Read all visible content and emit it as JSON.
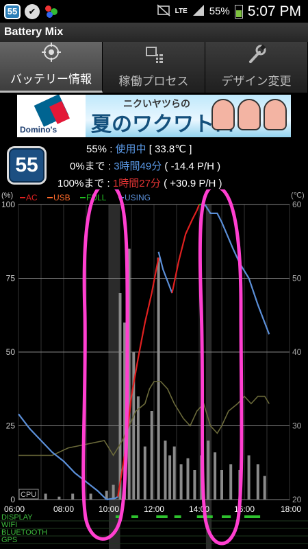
{
  "status_bar": {
    "badge": "55",
    "network": "LTE",
    "battery": "55%",
    "battery_level": 0.55,
    "time": "5:07 PM",
    "icons": [
      "battery-mix-badge-icon",
      "vine-icon",
      "app-icon",
      "mute-icon",
      "lte-icon",
      "signal-icon",
      "battery-icon"
    ]
  },
  "app": {
    "title": "Battery Mix"
  },
  "tabs": [
    {
      "label": "バッテリー情報",
      "icon": "target-icon",
      "active": true
    },
    {
      "label": "稼働プロセス",
      "icon": "process-list-icon",
      "active": false
    },
    {
      "label": "デザイン変更",
      "icon": "wrench-icon",
      "active": false
    }
  ],
  "ad": {
    "brand": "Domino's",
    "subtitle": "ニクいヤツらの",
    "title": "夏のワクワトロ"
  },
  "info": {
    "badge_value": "55",
    "level": "55%",
    "colon1": " : ",
    "state": "使用中",
    "temp": " [ 33.8℃ ]",
    "empty_label": "0%まで",
    "colon2": " : ",
    "empty_time": "3時間49分",
    "empty_rate": " ( -14.4 P/H )",
    "full_label": "100%まで",
    "colon3": " : ",
    "full_time": "1時間27分",
    "full_rate": " ( +30.9 P/H )"
  },
  "colors": {
    "ac": "#e02020",
    "usb": "#ff6a2a",
    "full": "#22c022",
    "using": "#5b8fd8",
    "highlight": "#ff3fd0"
  },
  "chart_data": {
    "type": "line",
    "legend": [
      "AC",
      "USB",
      "FULL",
      "USING"
    ],
    "left_axis_unit": "(%)",
    "right_axis_unit": "(℃)",
    "y_ticks": [
      0,
      25,
      50,
      75,
      100
    ],
    "y_right_ticks": [
      20,
      30,
      40,
      50,
      60
    ],
    "x_ticks": [
      "06:00",
      "08:00",
      "10:00",
      "12:00",
      "14:00",
      "16:00",
      "18:00"
    ],
    "xlim": [
      6,
      18
    ],
    "ylim": [
      0,
      100
    ],
    "y_right_lim": [
      20,
      60
    ],
    "bar_series_label": "CPU",
    "activity_rows": [
      "DISPLAY",
      "WIFI",
      "BLUETOOTH",
      "GPS"
    ],
    "series": [
      {
        "name": "USING",
        "color": "#5b8fd8",
        "x": [
          6.0,
          6.5,
          7.0,
          7.5,
          8.0,
          8.5,
          9.0,
          9.5,
          9.9
        ],
        "y": [
          29,
          24,
          20,
          16,
          13,
          9,
          6,
          3,
          0
        ]
      },
      {
        "name": "USING",
        "color": "#5b8fd8",
        "x": [
          9.9,
          10.3,
          10.4
        ],
        "y": [
          0,
          0.5,
          1
        ]
      },
      {
        "name": "AC",
        "color": "#e02020",
        "x": [
          10.4,
          10.7,
          11.0,
          11.3,
          11.6,
          11.9,
          12.2
        ],
        "y": [
          1,
          15,
          35,
          48,
          60,
          70,
          82
        ]
      },
      {
        "name": "USING",
        "color": "#5b8fd8",
        "x": [
          12.2,
          12.4,
          12.7,
          12.8
        ],
        "y": [
          84,
          78,
          72,
          70
        ]
      },
      {
        "name": "AC",
        "color": "#e02020",
        "x": [
          12.8,
          13.1,
          13.4,
          13.7,
          13.9,
          14.0
        ],
        "y": [
          70,
          81,
          90,
          95,
          98,
          100
        ]
      },
      {
        "name": "FULL",
        "color": "#22c022",
        "x": [
          14.0,
          14.25
        ],
        "y": [
          100,
          100
        ]
      },
      {
        "name": "USING",
        "color": "#5b8fd8",
        "x": [
          14.25,
          14.5,
          14.8,
          15.0,
          15.5,
          15.8,
          16.2,
          16.6,
          17.1
        ],
        "y": [
          100,
          97,
          97,
          94,
          85,
          80,
          75,
          66,
          56
        ]
      }
    ],
    "temperature": {
      "x": [
        6.0,
        7.5,
        8.2,
        9.0,
        9.8,
        10.2,
        10.6,
        10.9,
        11.2,
        11.6,
        11.8,
        12.0,
        12.3,
        12.6,
        12.9,
        13.3,
        13.6,
        13.9,
        14.2,
        14.5,
        14.8,
        15.0,
        15.3,
        15.7,
        16.0,
        16.3,
        16.6,
        16.9,
        17.1
      ],
      "y": [
        26,
        26,
        27,
        27.5,
        28,
        26,
        28,
        30,
        32,
        33,
        35,
        36,
        36,
        35,
        33,
        31,
        30,
        32,
        33,
        30,
        29,
        30,
        32,
        33,
        34,
        33,
        34,
        34,
        33
      ]
    },
    "charge_bars": [
      {
        "x": 6.6,
        "h": 2
      },
      {
        "x": 7.2,
        "h": 2
      },
      {
        "x": 7.8,
        "h": 1
      },
      {
        "x": 8.4,
        "h": 2
      },
      {
        "x": 9.2,
        "h": 2
      },
      {
        "x": 9.9,
        "h": 3
      },
      {
        "x": 10.2,
        "h": 5
      },
      {
        "x": 10.5,
        "h": 70
      },
      {
        "x": 10.7,
        "h": 60
      },
      {
        "x": 10.9,
        "h": 85
      },
      {
        "x": 11.1,
        "h": 50
      },
      {
        "x": 11.3,
        "h": 35
      },
      {
        "x": 11.6,
        "h": 18
      },
      {
        "x": 11.9,
        "h": 30
      },
      {
        "x": 12.2,
        "h": 82
      },
      {
        "x": 12.5,
        "h": 20
      },
      {
        "x": 12.7,
        "h": 15
      },
      {
        "x": 12.9,
        "h": 18
      },
      {
        "x": 13.2,
        "h": 12
      },
      {
        "x": 13.5,
        "h": 14
      },
      {
        "x": 13.8,
        "h": 10
      },
      {
        "x": 14.1,
        "h": 15
      },
      {
        "x": 14.4,
        "h": 20
      },
      {
        "x": 14.7,
        "h": 16
      },
      {
        "x": 15.0,
        "h": 10
      },
      {
        "x": 15.4,
        "h": 12
      },
      {
        "x": 15.8,
        "h": 10
      },
      {
        "x": 16.2,
        "h": 15
      },
      {
        "x": 16.6,
        "h": 12
      },
      {
        "x": 16.9,
        "h": 8
      }
    ],
    "screen_on_periods": [
      [
        10.0,
        10.5
      ],
      [
        14.3,
        14.55
      ]
    ]
  }
}
